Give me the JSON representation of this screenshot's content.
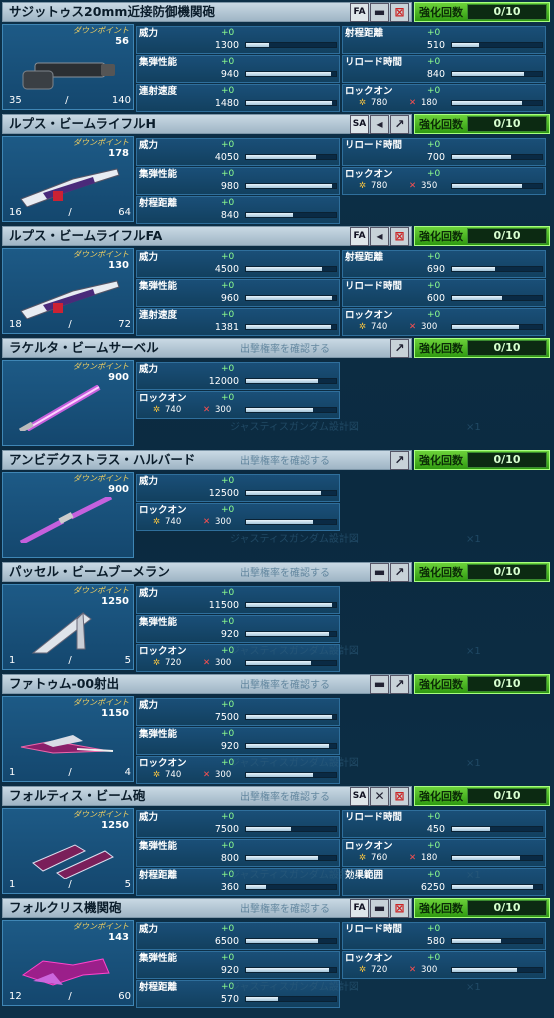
{
  "weapons": [
    {
      "name": "サジットゥス20mm近接防御機関砲",
      "tags": [
        "FA",
        "icon:▬",
        "icon:⊠"
      ],
      "enhance_label": "強化回数",
      "enhance": "0/10",
      "dp_label": "ダウンポイント",
      "dp": "56",
      "ammo_cur": "35",
      "ammo_sep": "/",
      "ammo_max": "140",
      "img": "gatling",
      "stats": [
        {
          "label": "威力",
          "plus": "+0",
          "value": "1300",
          "fill": 0.25,
          "col": 0,
          "row": 0
        },
        {
          "label": "集弾性能",
          "plus": "+0",
          "value": "940",
          "fill": 0.94,
          "col": 0,
          "row": 1
        },
        {
          "label": "連射速度",
          "plus": "+0",
          "value": "1480",
          "fill": 0.96,
          "col": 0,
          "row": 2
        },
        {
          "label": "射程距離",
          "plus": "+0",
          "value": "510",
          "fill": 0.3,
          "col": 1,
          "row": 0
        },
        {
          "label": "リロード時間",
          "plus": "+0",
          "value": "840",
          "fill": 0.8,
          "col": 1,
          "row": 1
        },
        {
          "label": "ロックオン",
          "plus": "+0",
          "lock1": "780",
          "lock2": "180",
          "fill": 0.78,
          "col": 1,
          "row": 2
        }
      ]
    },
    {
      "name": "ルプス・ビームライフルH",
      "tags": [
        "SA",
        "icon:◂",
        "icon:↗"
      ],
      "enhance_label": "強化回数",
      "enhance": "0/10",
      "dp_label": "ダウンポイント",
      "dp": "178",
      "ammo_cur": "16",
      "ammo_sep": "/",
      "ammo_max": "64",
      "img": "rifle",
      "stats": [
        {
          "label": "威力",
          "plus": "+0",
          "value": "4050",
          "fill": 0.78,
          "col": 0,
          "row": 0
        },
        {
          "label": "集弾性能",
          "plus": "+0",
          "value": "980",
          "fill": 0.96,
          "col": 0,
          "row": 1
        },
        {
          "label": "射程距離",
          "plus": "+0",
          "value": "840",
          "fill": 0.52,
          "col": 0,
          "row": 2
        },
        {
          "label": "リロード時間",
          "plus": "+0",
          "value": "700",
          "fill": 0.65,
          "col": 1,
          "row": 0
        },
        {
          "label": "ロックオン",
          "plus": "+0",
          "lock1": "780",
          "lock2": "350",
          "fill": 0.78,
          "col": 1,
          "row": 1
        }
      ]
    },
    {
      "name": "ルプス・ビームライフルFA",
      "tags": [
        "FA",
        "icon:◂",
        "icon:⊠"
      ],
      "enhance_label": "強化回数",
      "enhance": "0/10",
      "dp_label": "ダウンポイント",
      "dp": "130",
      "ammo_cur": "18",
      "ammo_sep": "/",
      "ammo_max": "72",
      "img": "rifle",
      "stats": [
        {
          "label": "威力",
          "plus": "+0",
          "value": "4500",
          "fill": 0.84,
          "col": 0,
          "row": 0
        },
        {
          "label": "集弾性能",
          "plus": "+0",
          "value": "960",
          "fill": 0.95,
          "col": 0,
          "row": 1
        },
        {
          "label": "連射速度",
          "plus": "+0",
          "value": "1381",
          "fill": 0.94,
          "col": 0,
          "row": 2
        },
        {
          "label": "射程距離",
          "plus": "+0",
          "value": "690",
          "fill": 0.48,
          "col": 1,
          "row": 0
        },
        {
          "label": "リロード時間",
          "plus": "+0",
          "value": "600",
          "fill": 0.55,
          "col": 1,
          "row": 1
        },
        {
          "label": "ロックオン",
          "plus": "+0",
          "lock1": "740",
          "lock2": "300",
          "fill": 0.74,
          "col": 1,
          "row": 2
        }
      ]
    },
    {
      "name": "ラケルタ・ビームサーベル",
      "tags": [
        "icon:↗"
      ],
      "enhance_label": "強化回数",
      "enhance": "0/10",
      "dp_label": "ダウンポイント",
      "dp": "900",
      "img": "saber",
      "stats": [
        {
          "label": "威力",
          "plus": "+0",
          "value": "12000",
          "fill": 0.8,
          "col": 0,
          "row": 0
        },
        {
          "label": "ロックオン",
          "plus": "+0",
          "lock1": "740",
          "lock2": "300",
          "fill": 0.74,
          "col": 0,
          "row": 1
        }
      ]
    },
    {
      "name": "アンビデクストラス・ハルバード",
      "tags": [
        "icon:↗"
      ],
      "enhance_label": "強化回数",
      "enhance": "0/10",
      "dp_label": "ダウンポイント",
      "dp": "900",
      "img": "halberd",
      "stats": [
        {
          "label": "威力",
          "plus": "+0",
          "value": "12500",
          "fill": 0.83,
          "col": 0,
          "row": 0
        },
        {
          "label": "ロックオン",
          "plus": "+0",
          "lock1": "740",
          "lock2": "300",
          "fill": 0.74,
          "col": 0,
          "row": 1
        }
      ]
    },
    {
      "name": "パッセル・ビームブーメラン",
      "tags": [
        "icon:▬",
        "icon:↗"
      ],
      "enhance_label": "強化回数",
      "enhance": "0/10",
      "dp_label": "ダウンポイント",
      "dp": "1250",
      "ammo_cur": "1",
      "ammo_sep": "/",
      "ammo_max": "5",
      "img": "boomerang",
      "stats": [
        {
          "label": "威力",
          "plus": "+0",
          "value": "11500",
          "fill": 0.96,
          "col": 0,
          "row": 0
        },
        {
          "label": "集弾性能",
          "plus": "+0",
          "value": "920",
          "fill": 0.92,
          "col": 0,
          "row": 1
        },
        {
          "label": "ロックオン",
          "plus": "+0",
          "lock1": "720",
          "lock2": "300",
          "fill": 0.72,
          "col": 0,
          "row": 2
        }
      ]
    },
    {
      "name": "ファトゥム-00射出",
      "tags": [
        "icon:▬",
        "icon:↗"
      ],
      "enhance_label": "強化回数",
      "enhance": "0/10",
      "dp_label": "ダウンポイント",
      "dp": "1150",
      "ammo_cur": "1",
      "ammo_sep": "/",
      "ammo_max": "4",
      "img": "fatum",
      "stats": [
        {
          "label": "威力",
          "plus": "+0",
          "value": "7500",
          "fill": 0.96,
          "col": 0,
          "row": 0
        },
        {
          "label": "集弾性能",
          "plus": "+0",
          "value": "920",
          "fill": 0.92,
          "col": 0,
          "row": 1
        },
        {
          "label": "ロックオン",
          "plus": "+0",
          "lock1": "740",
          "lock2": "300",
          "fill": 0.74,
          "col": 0,
          "row": 2
        }
      ]
    },
    {
      "name": "フォルティス・ビーム砲",
      "tags": [
        "SA",
        "icon:✕",
        "icon:⊠"
      ],
      "enhance_label": "強化回数",
      "enhance": "0/10",
      "dp_label": "ダウンポイント",
      "dp": "1250",
      "ammo_cur": "1",
      "ammo_sep": "/",
      "ammo_max": "5",
      "img": "cannon",
      "stats": [
        {
          "label": "威力",
          "plus": "+0",
          "value": "7500",
          "fill": 0.5,
          "col": 0,
          "row": 0
        },
        {
          "label": "集弾性能",
          "plus": "+0",
          "value": "800",
          "fill": 0.8,
          "col": 0,
          "row": 1
        },
        {
          "label": "射程距離",
          "plus": "+0",
          "value": "360",
          "fill": 0.22,
          "col": 0,
          "row": 2
        },
        {
          "label": "リロード時間",
          "plus": "+0",
          "value": "450",
          "fill": 0.42,
          "col": 1,
          "row": 0
        },
        {
          "label": "ロックオン",
          "plus": "+0",
          "lock1": "760",
          "lock2": "180",
          "fill": 0.76,
          "col": 1,
          "row": 1
        },
        {
          "label": "効果範囲",
          "plus": "+0",
          "value": "6250",
          "fill": 0.9,
          "col": 1,
          "row": 2
        }
      ]
    },
    {
      "name": "フォルクリス機関砲",
      "tags": [
        "FA",
        "icon:▬",
        "icon:⊠"
      ],
      "enhance_label": "強化回数",
      "enhance": "0/10",
      "dp_label": "ダウンポイント",
      "dp": "143",
      "ammo_cur": "12",
      "ammo_sep": "/",
      "ammo_max": "60",
      "img": "folkris",
      "stats": [
        {
          "label": "威力",
          "plus": "+0",
          "value": "6500",
          "fill": 0.8,
          "col": 0,
          "row": 0
        },
        {
          "label": "集弾性能",
          "plus": "+0",
          "value": "920",
          "fill": 0.92,
          "col": 0,
          "row": 1
        },
        {
          "label": "射程距離",
          "plus": "+0",
          "value": "570",
          "fill": 0.35,
          "col": 0,
          "row": 2
        },
        {
          "label": "リロード時間",
          "plus": "+0",
          "value": "580",
          "fill": 0.54,
          "col": 1,
          "row": 0
        },
        {
          "label": "ロックオン",
          "plus": "+0",
          "lock1": "720",
          "lock2": "300",
          "fill": 0.72,
          "col": 1,
          "row": 1
        }
      ]
    }
  ],
  "ghost_text": [
    "出撃権率を確認する",
    "ジャスティスガンダム設計図",
    "×1"
  ],
  "colors": {
    "enhance_green": "#3fb01c",
    "lock_yellow": "#f2c040",
    "lock_red": "#ff5050",
    "plus_green": "#8fff8f"
  }
}
